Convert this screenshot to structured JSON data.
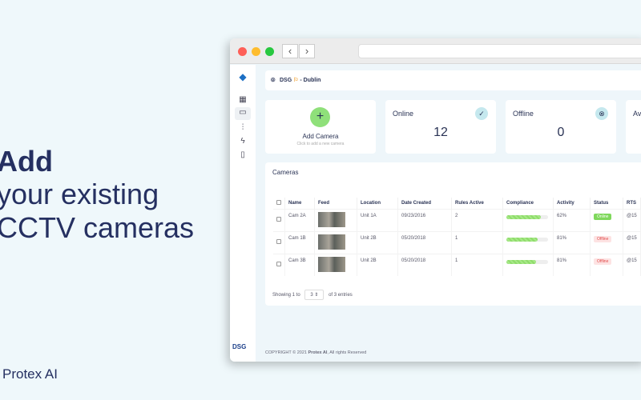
{
  "hero": {
    "line1": "Add",
    "line2": "your existing",
    "line3": "CCTV cameras"
  },
  "brand": "Protex AI",
  "header": {
    "location": "DSG",
    "site": "Dublin",
    "separator": "-"
  },
  "add_camera": {
    "title": "Add Camera",
    "subtitle": "Click to add a new camera"
  },
  "stats": [
    {
      "label": "Online",
      "value": "12"
    },
    {
      "label": "Offline",
      "value": "0"
    },
    {
      "label": "Av"
    }
  ],
  "cameras": {
    "title": "Cameras",
    "columns": [
      "Name",
      "Feed",
      "Location",
      "Date Created",
      "Rules Active",
      "Compliance",
      "Activity",
      "Status",
      "RTS"
    ],
    "rows": [
      {
        "name": "Cam 2A",
        "location": "Unit 1A",
        "date": "09/23/2016",
        "rules": "2",
        "compliance": 82,
        "activity": "62%",
        "status": "Online",
        "rts": "@15"
      },
      {
        "name": "Cam 1B",
        "location": "Unit 2B",
        "date": "05/20/2018",
        "rules": "1",
        "compliance": 75,
        "activity": "81%",
        "status": "Offline",
        "rts": "@15"
      },
      {
        "name": "Cam 3B",
        "location": "Unit 2B",
        "date": "05/20/2018",
        "rules": "1",
        "compliance": 72,
        "activity": "81%",
        "status": "Offline",
        "rts": "@15"
      }
    ],
    "showing_prefix": "Showing 1 to",
    "page_size": "3",
    "showing_suffix": "of 3 entries"
  },
  "footer": {
    "copyright": "COPYRIGHT © 2021",
    "company": "Protex AI",
    "rights": ", All rights Reserved"
  },
  "sidebar_logo": "DSG"
}
